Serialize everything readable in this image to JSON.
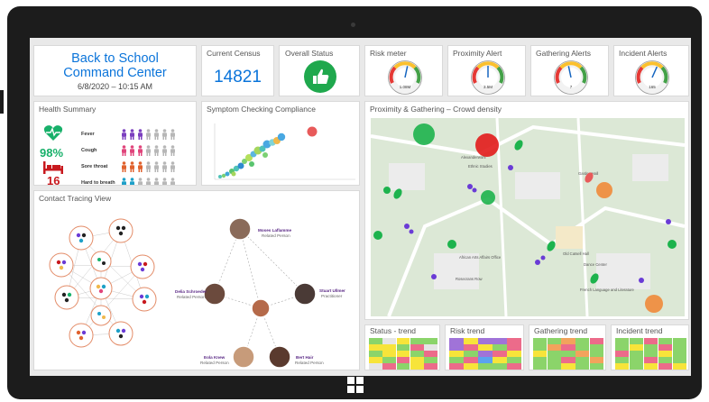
{
  "header": {
    "title_line1": "Back to School",
    "title_line2": "Command Center",
    "datetime": "6/8/2020 – 10:15 AM"
  },
  "census": {
    "label": "Current Census",
    "value": "14821"
  },
  "status": {
    "label": "Overall Status",
    "icon": "thumbs-up-icon",
    "color": "#1fa84d"
  },
  "meters": [
    {
      "label": "Risk meter",
      "value": "1.08M",
      "level": 0.55
    },
    {
      "label": "Proximity Alert",
      "value": "3.5M",
      "level": 0.5
    },
    {
      "label": "Gathering Alerts",
      "value": "7",
      "level": 0.45
    },
    {
      "label": "Incident Alerts",
      "value": "165",
      "level": 0.6
    }
  ],
  "health": {
    "title": "Health Summary",
    "percent": "98%",
    "beds": "16",
    "items": [
      {
        "label": "Fever",
        "color": "#7b3fbf",
        "highlighted": 3
      },
      {
        "label": "Cough",
        "color": "#e0457b",
        "highlighted": 3
      },
      {
        "label": "Sore throat",
        "color": "#e0622e",
        "highlighted": 3
      },
      {
        "label": "Hard to breath",
        "color": "#1ea0c8",
        "highlighted": 2
      }
    ]
  },
  "compliance": {
    "title": "Symptom Checking Compliance"
  },
  "map": {
    "title": "Proximity & Gathering – Crowd density",
    "labels": [
      "Alexanderwohl",
      "Ethnic Studies",
      "Garden Hall",
      "Old Catsell Hall",
      "African Arts Affairs Office",
      "Rosecrans Row",
      "Dance Center",
      "French Language and Literature"
    ]
  },
  "contact": {
    "title": "Contact Tracing View",
    "people": [
      {
        "name": "Moses Laflamme",
        "role": "Related Person"
      },
      {
        "name": "Delia Schroeder",
        "role": "Related Person"
      },
      {
        "name": "Stuart Ullmer",
        "role": "Practitioner"
      },
      {
        "name": "Eola Knew",
        "role": "Related Person"
      },
      {
        "name": "Bert Hair",
        "role": "Related Person"
      }
    ]
  },
  "trends": [
    {
      "label": "Status - trend"
    },
    {
      "label": "Risk trend"
    },
    {
      "label": "Gathering trend"
    },
    {
      "label": "Incident trend"
    }
  ]
}
